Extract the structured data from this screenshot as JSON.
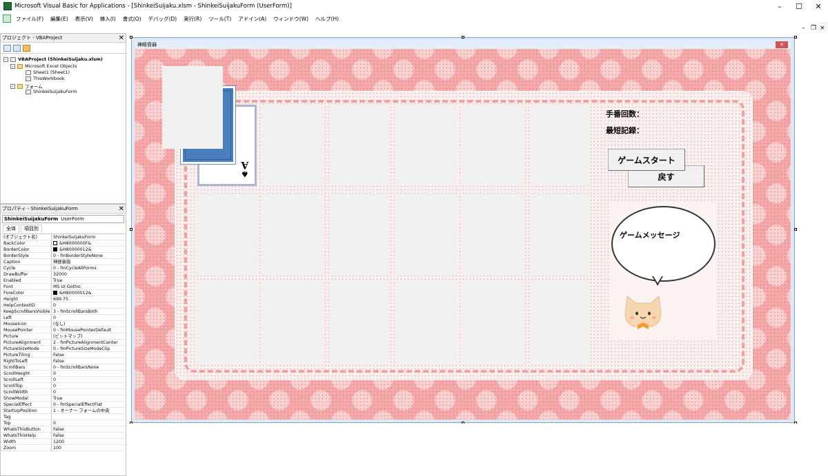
{
  "window": {
    "title": "Microsoft Visual Basic for Applications - [ShinkeiSuijaku.xlsm - ShinkeiSuijakuForm (UserForm)]",
    "minimize": "–",
    "maximize": "☐",
    "close": "✕"
  },
  "menu": [
    "ファイル(F)",
    "編集(E)",
    "表示(V)",
    "挿入(I)",
    "書式(O)",
    "デバッグ(D)",
    "実行(R)",
    "ツール(T)",
    "アドイン(A)",
    "ウィンドウ(W)",
    "ヘルプ(H)"
  ],
  "mdi_controls": {
    "minimize": "–",
    "restore": "❐",
    "close": "×"
  },
  "project_panel": {
    "title": "プロジェクト - VBAProject",
    "close": "✕",
    "tree": [
      {
        "label": "VBAProject (ShinkeiSuijaku.xlsm)",
        "level": 0,
        "bold": true
      },
      {
        "label": "Microsoft Excel Objects",
        "level": 1
      },
      {
        "label": "Sheet1 (Sheet1)",
        "level": 2
      },
      {
        "label": "ThisWorkbook",
        "level": 2
      },
      {
        "label": "フォーム",
        "level": 1
      },
      {
        "label": "ShinkeiSuijakuForm",
        "level": 2
      }
    ]
  },
  "properties_panel": {
    "title": "プロパティ - ShinkeiSuijakuForm",
    "close": "✕",
    "object_name": "ShinkeiSuijakuForm",
    "object_type": "UserForm",
    "tabs": [
      "全体",
      "項目別"
    ],
    "rows": [
      [
        "(オブジェクト名)",
        "ShinkeiSuijakuForm"
      ],
      [
        "BackColor",
        "&H8000000F&"
      ],
      [
        "BorderColor",
        "&H80000012&"
      ],
      [
        "BorderStyle",
        "0 - fmBorderStyleNone"
      ],
      [
        "Caption",
        "神経衰弱"
      ],
      [
        "Cycle",
        "0 - fmCycleAllForms"
      ],
      [
        "DrawBuffer",
        "32000"
      ],
      [
        "Enabled",
        "True"
      ],
      [
        "Font",
        "MS UI Gothic"
      ],
      [
        "ForeColor",
        "&H80000012&"
      ],
      [
        "Height",
        "699.75"
      ],
      [
        "HelpContextID",
        "0"
      ],
      [
        "KeepScrollBarsVisible",
        "3 - fmScrollBarsBoth"
      ],
      [
        "Left",
        "0"
      ],
      [
        "MouseIcon",
        "(なし)"
      ],
      [
        "MousePointer",
        "0 - fmMousePointerDefault"
      ],
      [
        "Picture",
        "(ビットマップ)"
      ],
      [
        "PictureAlignment",
        "2 - fmPictureAlignmentCenter"
      ],
      [
        "PictureSizeMode",
        "0 - fmPictureSizeModeClip"
      ],
      [
        "PictureTiling",
        "False"
      ],
      [
        "RightToLeft",
        "False"
      ],
      [
        "ScrollBars",
        "0 - fmScrollBarsNone"
      ],
      [
        "ScrollHeight",
        "0"
      ],
      [
        "ScrollLeft",
        "0"
      ],
      [
        "ScrollTop",
        "0"
      ],
      [
        "ScrollWidth",
        "0"
      ],
      [
        "ShowModal",
        "True"
      ],
      [
        "SpecialEffect",
        "0 - fmSpecialEffectFlat"
      ],
      [
        "StartUpPosition",
        "1 - オーナー フォームの中央"
      ],
      [
        "Tag",
        ""
      ],
      [
        "Top",
        "0"
      ],
      [
        "WhatsThisButton",
        "False"
      ],
      [
        "WhatsThisHelp",
        "False"
      ],
      [
        "Width",
        "1200"
      ],
      [
        "Zoom",
        "100"
      ]
    ],
    "swatch_colors": {
      "BackColor": "#f0f0f0",
      "BorderColor": "#000000",
      "ForeColor": "#000000"
    }
  },
  "form": {
    "caption": "神経衰弱",
    "close": "✕",
    "move_count_label": "手番回数：",
    "best_record_label": "最短記録：",
    "start_button": "ゲームスタート",
    "back_button": "戻す",
    "message": "ゲームメッセージ",
    "ace_rank": "A",
    "ace_suit": "♠",
    "colors": {
      "background": "#f7a9a9",
      "board": "#f8f0ef",
      "dash": "#f4a0a0",
      "card_back": "#4a7fbd"
    }
  }
}
